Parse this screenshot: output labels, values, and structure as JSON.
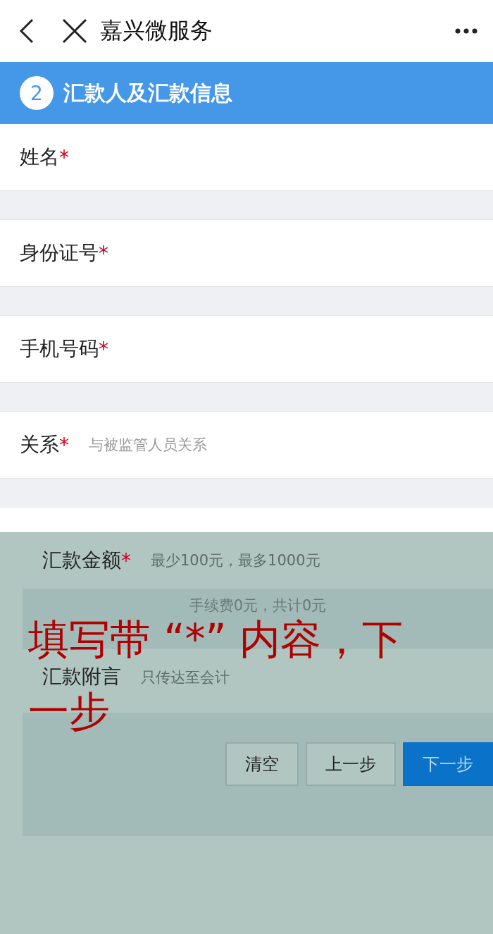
{
  "header": {
    "title": "嘉兴微服务"
  },
  "section": {
    "step": "2",
    "title": "汇款人及汇款信息"
  },
  "fields": [
    {
      "label": "姓名",
      "mark": "*"
    },
    {
      "label": "身份证号",
      "mark": "*"
    },
    {
      "label": "手机号码",
      "mark": "*"
    },
    {
      "label": "关系",
      "mark": "*",
      "placeholder": "与被监管人员关系"
    }
  ],
  "lower_panel": {
    "fields": [
      {
        "kind": "input",
        "label": "汇款金额",
        "mark": "*",
        "placeholder": "最少100元，最多1000元"
      },
      {
        "kind": "summary",
        "text": "手续费0元，共计0元"
      },
      {
        "kind": "input",
        "label": "汇款附言",
        "placeholder": "只传达至会计"
      }
    ],
    "buttons": [
      {
        "label": "清空",
        "primary": false
      },
      {
        "label": "上一步",
        "primary": false
      },
      {
        "label": "下一步",
        "primary": true
      }
    ]
  },
  "annotation": {
    "lines": [
      "填写带 “*” 内容，下",
      "一步"
    ]
  }
}
